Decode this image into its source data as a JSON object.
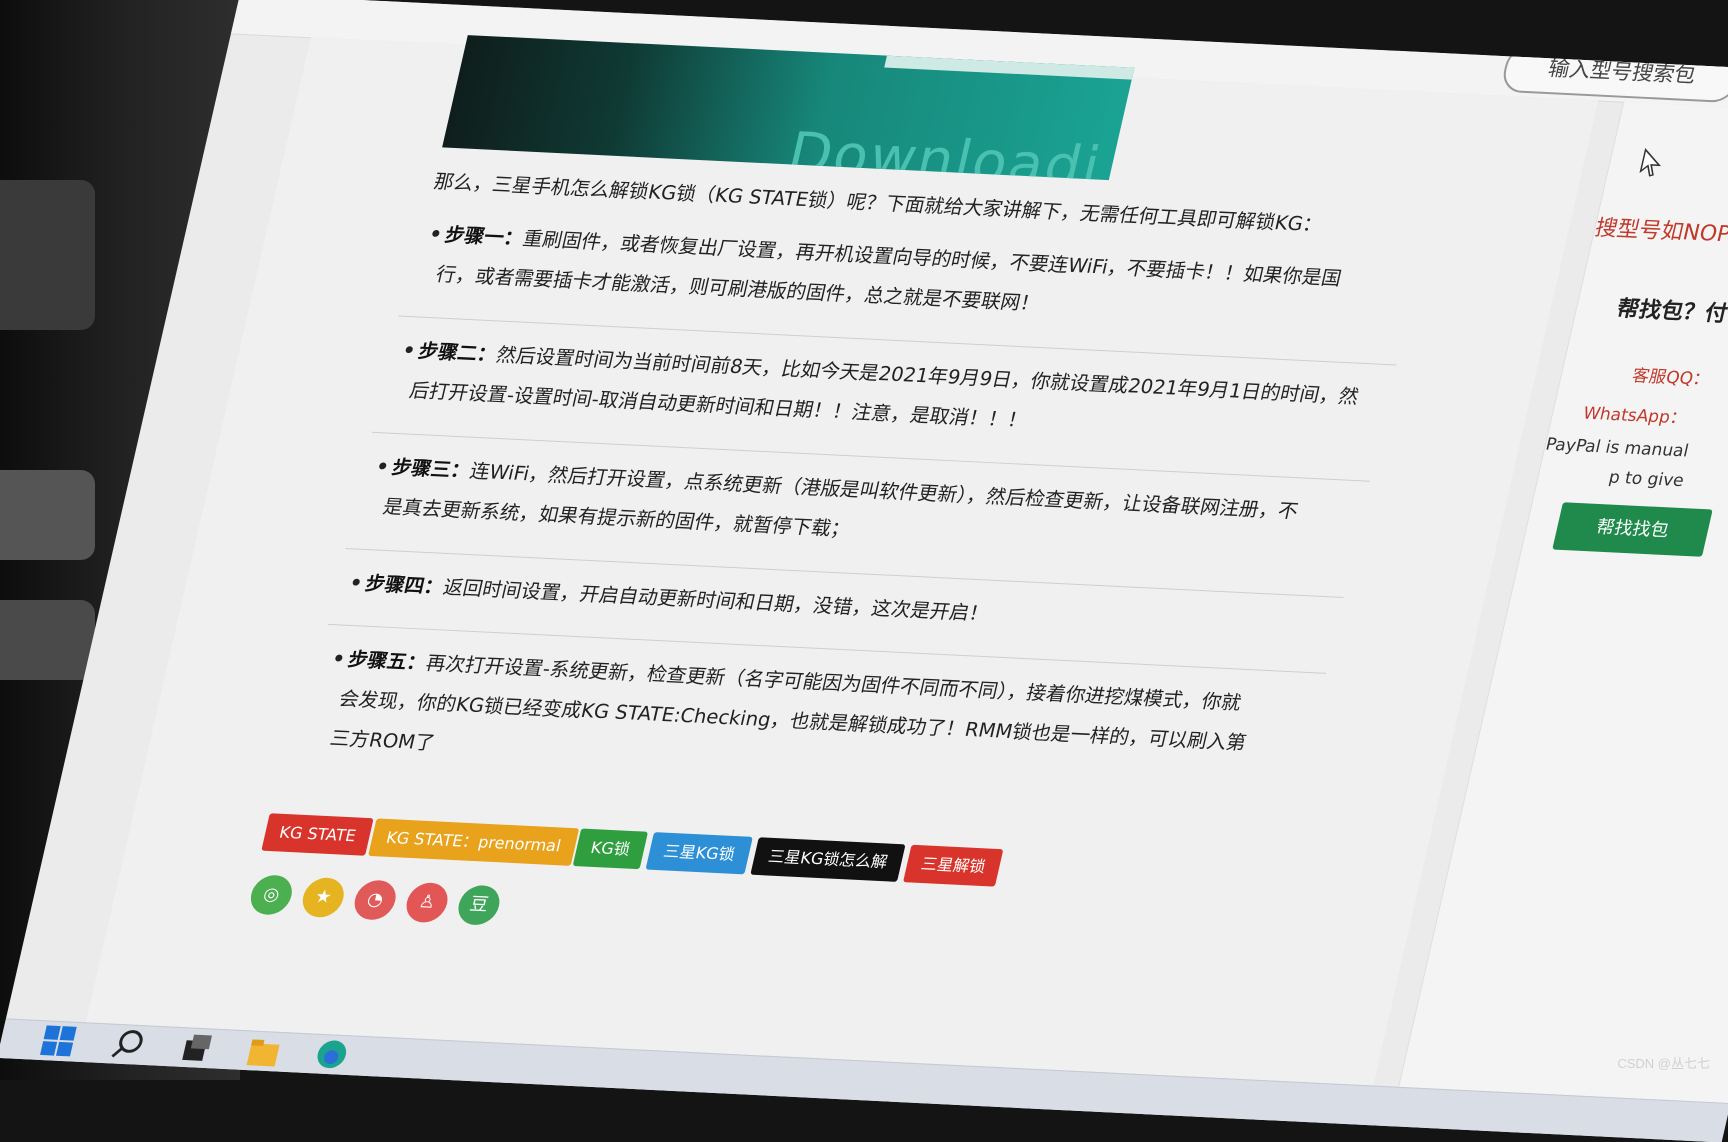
{
  "header": {
    "search_placeholder": "输入型号搜索包"
  },
  "hero": {
    "text_fragment": "Downloadi"
  },
  "article": {
    "intro": "那么，三星手机怎么解锁KG锁（KG STATE锁）呢？下面就给大家讲解下，无需任何工具即可解锁KG：",
    "steps": [
      {
        "label": "步骤一：",
        "line1": "重刷固件，或者恢复出厂设置，再开机设置向导的时候，不要连WiFi，不要插卡！！如果你是国",
        "line2": "行，或者需要插卡才能激活，则可刷港版的固件，总之就是不要联网！"
      },
      {
        "label": "步骤二：",
        "line1": "然后设置时间为当前时间前8天，比如今天是2021年9月9日，你就设置成2021年9月1日的时间，然",
        "line2": "后打开设置-设置时间-取消自动更新时间和日期！！注意，是取消！！！"
      },
      {
        "label": "步骤三：",
        "line1": "连WiFi，然后打开设置，点系统更新（港版是叫软件更新），然后检查更新，让设备联网注册，不",
        "line2": "是真去更新系统，如果有提示新的固件，就暂停下载；"
      },
      {
        "label": "步骤四：",
        "line1": "返回时间设置，开启自动更新时间和日期，没错，这次是开启！",
        "line2": ""
      },
      {
        "label": "步骤五：",
        "line1": "再次打开设置-系统更新，检查更新（名字可能因为固件不同而不同），接着你进挖煤模式，你就",
        "line2": "会发现，你的KG锁已经变成KG STATE:Checking，也就是解锁成功了！RMM锁也是一样的，可以刷入第",
        "line3": "三方ROM了"
      }
    ],
    "tags": [
      {
        "label": "KG STATE",
        "color": "#d9342b"
      },
      {
        "label": "KG STATE：prenormal",
        "color": "#e8a21c"
      },
      {
        "label": "KG锁",
        "color": "#2e9e3f"
      },
      {
        "label": "三星KG锁",
        "color": "#2d8fd5"
      },
      {
        "label": "三星KG锁怎么解",
        "color": "#111111"
      },
      {
        "label": "三星解锁",
        "color": "#d9342b"
      }
    ],
    "share": [
      {
        "icon": "wechat-icon",
        "glyph": "◎",
        "color": "#4caf50"
      },
      {
        "icon": "qzone-icon",
        "glyph": "★",
        "color": "#e5b420"
      },
      {
        "icon": "weibo-icon",
        "glyph": "◔",
        "color": "#e05a5a"
      },
      {
        "icon": "qq-icon",
        "glyph": "♙",
        "color": "#e35656"
      },
      {
        "icon": "douban-icon",
        "glyph": "豆",
        "color": "#3ea55a"
      }
    ]
  },
  "sidebar": {
    "title": "搜型号如NOP",
    "help": "帮找包？",
    "help_suffix": "付",
    "qq_label": "客服QQ：",
    "whatsapp_label": "WhatsApp：",
    "paypal_line1": "PayPal is manual",
    "paypal_line2": "p to give",
    "find_button": "帮找找包"
  },
  "watermark": "CSDN @丛七七",
  "taskbar": {
    "icons": [
      "windows-start-icon",
      "search-icon",
      "task-view-icon",
      "file-explorer-icon",
      "edge-browser-icon"
    ]
  }
}
